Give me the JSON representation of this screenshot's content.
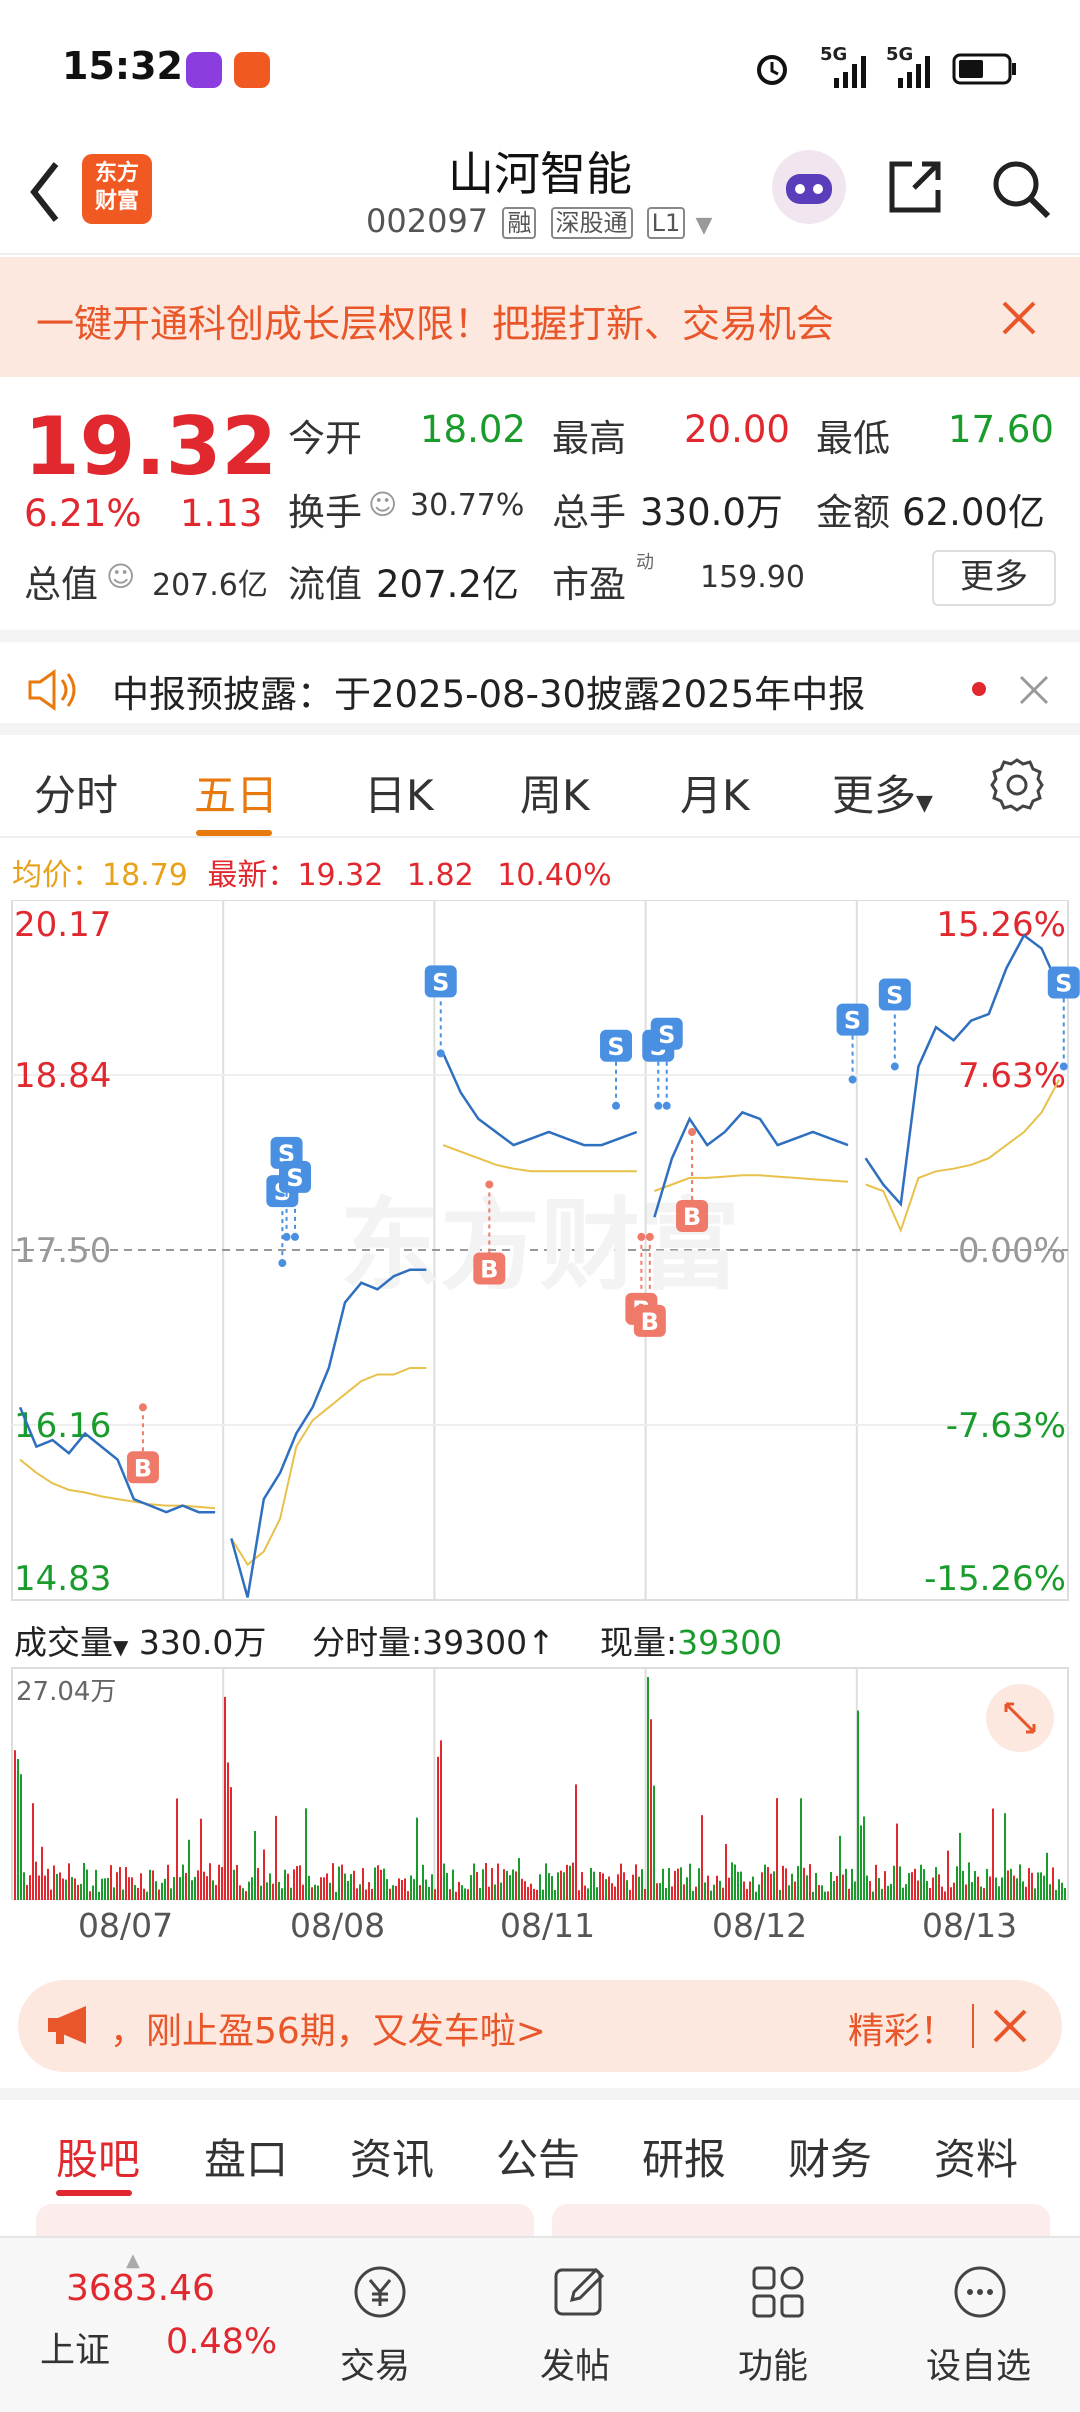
{
  "status": {
    "time": "15:32",
    "net1": "5G",
    "net2": "5G"
  },
  "header": {
    "back": "back",
    "logo_line1": "东方",
    "logo_line2": "财富",
    "title": "山河智能",
    "code": "002097",
    "tag_margin": "融",
    "tag_connect": "深股通",
    "tag_level": "L1"
  },
  "banner": {
    "text": "一键开通科创成长层权限！把握打新、交易机会"
  },
  "quote": {
    "price": "19.32",
    "change_pct": "6.21%",
    "change_amt": "1.13",
    "open_label": "今开",
    "open": "18.02",
    "high_label": "最高",
    "high": "20.00",
    "low_label": "最低",
    "low": "17.60",
    "turnover_label": "换手",
    "turnover": "30.77%",
    "volume_label": "总手",
    "volume": "330.0万",
    "amount_label": "金额",
    "amount": "62.00亿",
    "mktcap_label": "总值",
    "mktcap": "207.6亿",
    "float_label": "流值",
    "float": "207.2亿",
    "pe_label": "市盈",
    "pe_sup": "动",
    "pe": "159.90",
    "more": "更多"
  },
  "notice": {
    "text": "中报预披露：于2025-08-30披露2025年中报"
  },
  "tabs": [
    "分时",
    "五日",
    "日K",
    "周K",
    "月K",
    "更多"
  ],
  "info": {
    "avg_label": "均价：",
    "avg": "18.79",
    "latest_label": "最新：",
    "latest": "19.32",
    "chg": "1.82",
    "chg_pct": "10.40%"
  },
  "chart_data": {
    "type": "line",
    "title": "",
    "days": [
      "08/07",
      "08/08",
      "08/11",
      "08/12",
      "08/13"
    ],
    "left_ticks": [
      "20.17",
      "18.84",
      "17.50",
      "16.16",
      "14.83"
    ],
    "right_ticks": [
      "15.26%",
      "7.63%",
      "0.00%",
      "-7.63%",
      "-15.26%"
    ],
    "ylim": [
      14.83,
      20.17
    ],
    "prev_close": 17.5,
    "watermark": "东方财富",
    "series": [
      {
        "name": "price",
        "color": "#2f6fc0",
        "values": [
          16.3,
          16.0,
          16.05,
          15.95,
          16.1,
          16.0,
          15.9,
          15.6,
          15.55,
          15.5,
          15.55,
          15.5,
          15.5,
          15.3,
          14.85,
          15.6,
          15.8,
          16.1,
          16.3,
          16.6,
          17.1,
          17.25,
          17.2,
          17.3,
          17.35,
          17.35,
          19.0,
          18.7,
          18.5,
          18.4,
          18.3,
          18.35,
          18.4,
          18.35,
          18.3,
          18.3,
          18.35,
          18.4,
          17.75,
          18.2,
          18.5,
          18.3,
          18.4,
          18.55,
          18.5,
          18.3,
          18.35,
          18.4,
          18.35,
          18.3,
          18.2,
          18.0,
          17.85,
          18.9,
          19.2,
          19.1,
          19.25,
          19.3,
          19.65,
          19.9,
          19.8,
          19.5
        ]
      },
      {
        "name": "average",
        "color": "#e8c14a",
        "values": [
          15.9,
          15.8,
          15.72,
          15.67,
          15.65,
          15.62,
          15.6,
          15.58,
          15.56,
          15.55,
          15.55,
          15.54,
          15.53,
          15.3,
          15.1,
          15.2,
          15.45,
          16.0,
          16.2,
          16.3,
          16.4,
          16.5,
          16.55,
          16.55,
          16.6,
          16.6,
          18.3,
          18.25,
          18.2,
          18.15,
          18.12,
          18.1,
          18.1,
          18.1,
          18.1,
          18.1,
          18.1,
          18.1,
          17.95,
          18.0,
          18.05,
          18.05,
          18.06,
          18.07,
          18.07,
          18.06,
          18.05,
          18.04,
          18.03,
          18.02,
          18.0,
          17.95,
          17.65,
          18.05,
          18.1,
          18.12,
          18.15,
          18.2,
          18.3,
          18.4,
          18.55,
          18.8
        ]
      }
    ],
    "volume": {
      "max_label": "27.04万",
      "label": "成交量",
      "total": "330.0万",
      "period_label": "分时量:",
      "period": "39300↑",
      "now_label": "现量:",
      "now": "39300"
    },
    "markers": [
      {
        "type": "B",
        "day": 0,
        "t": 0.62,
        "price": 16.3
      },
      {
        "type": "S",
        "day": 1,
        "t": 0.28,
        "price": 17.4
      },
      {
        "type": "S",
        "day": 1,
        "t": 0.3,
        "price": 17.6
      },
      {
        "type": "S",
        "day": 1,
        "t": 0.34,
        "price": 17.6
      },
      {
        "type": "S",
        "day": 2,
        "t": 0.03,
        "price": 19.0
      },
      {
        "type": "B",
        "day": 2,
        "t": 0.26,
        "price": 18.0
      },
      {
        "type": "S",
        "day": 2,
        "t": 0.86,
        "price": 18.6
      },
      {
        "type": "B",
        "day": 2,
        "t": 0.98,
        "price": 17.6
      },
      {
        "type": "B",
        "day": 3,
        "t": 0.02,
        "price": 17.6
      },
      {
        "type": "S",
        "day": 3,
        "t": 0.06,
        "price": 18.6
      },
      {
        "type": "S",
        "day": 3,
        "t": 0.1,
        "price": 18.6
      },
      {
        "type": "B",
        "day": 3,
        "t": 0.22,
        "price": 18.4
      },
      {
        "type": "S",
        "day": 3,
        "t": 0.98,
        "price": 18.8
      },
      {
        "type": "S",
        "day": 4,
        "t": 0.18,
        "price": 18.9
      },
      {
        "type": "S",
        "day": 4,
        "t": 0.98,
        "price": 18.9
      }
    ]
  },
  "ad": {
    "text": "，刚止盈56期，又发车啦>",
    "cta": "精彩！"
  },
  "bottom_tabs": [
    "股吧",
    "盘口",
    "资讯",
    "公告",
    "研报",
    "财务",
    "资料"
  ],
  "bottom_bar": {
    "index_value": "3683.46",
    "index_name": "上证",
    "index_change": "0.48%",
    "trade": "交易",
    "post": "发帖",
    "func": "功能",
    "watch": "设自选"
  },
  "colors": {
    "red": "#e0282e",
    "green": "#1a9c2c",
    "orange": "#e8790e",
    "blue": "#2f6fc0",
    "avg": "#e8c14a"
  }
}
